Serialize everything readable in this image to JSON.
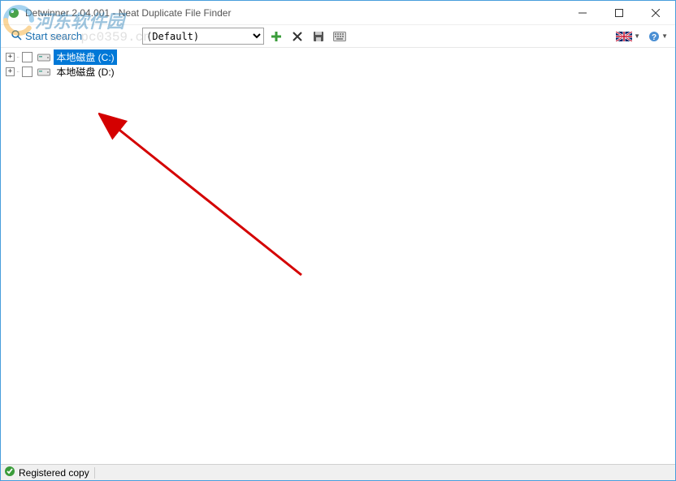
{
  "window": {
    "title": "Detwinner 2.04.001 - Neat Duplicate File Finder"
  },
  "toolbar": {
    "start_label": "Start search",
    "profile_selected": "(Default)",
    "icons": {
      "add": "add-icon",
      "delete": "delete-icon",
      "save": "save-icon",
      "keyboard": "keyboard-icon",
      "language": "language-flag-icon",
      "help": "help-icon"
    }
  },
  "tree": {
    "items": [
      {
        "label": "本地磁盘 (C:)",
        "selected": true
      },
      {
        "label": "本地磁盘 (D:)",
        "selected": false
      }
    ]
  },
  "statusbar": {
    "text": "Registered copy"
  },
  "watermark": {
    "site_name": "河东软件园",
    "site_url": "www.pc0359.cn"
  }
}
